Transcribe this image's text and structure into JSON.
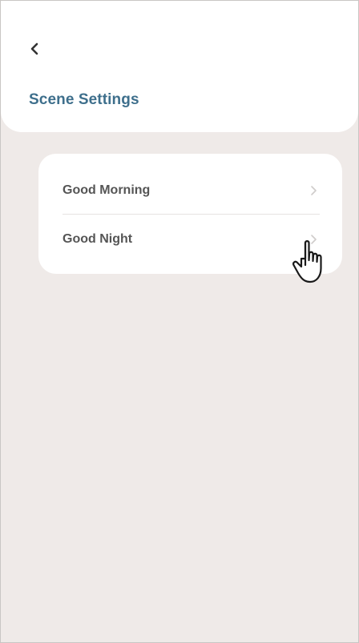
{
  "header": {
    "back_icon": "chevron-left-icon",
    "title": "Scene Settings"
  },
  "scenes": [
    {
      "label": "Good Morning",
      "icon": "chevron-right-icon"
    },
    {
      "label": "Good Night",
      "icon": "chevron-right-icon"
    }
  ],
  "colors": {
    "title": "#3e6f8c",
    "background": "#efeae8",
    "card": "#ffffff",
    "label": "#555555"
  },
  "cursor": {
    "icon": "hand-pointer-icon"
  }
}
